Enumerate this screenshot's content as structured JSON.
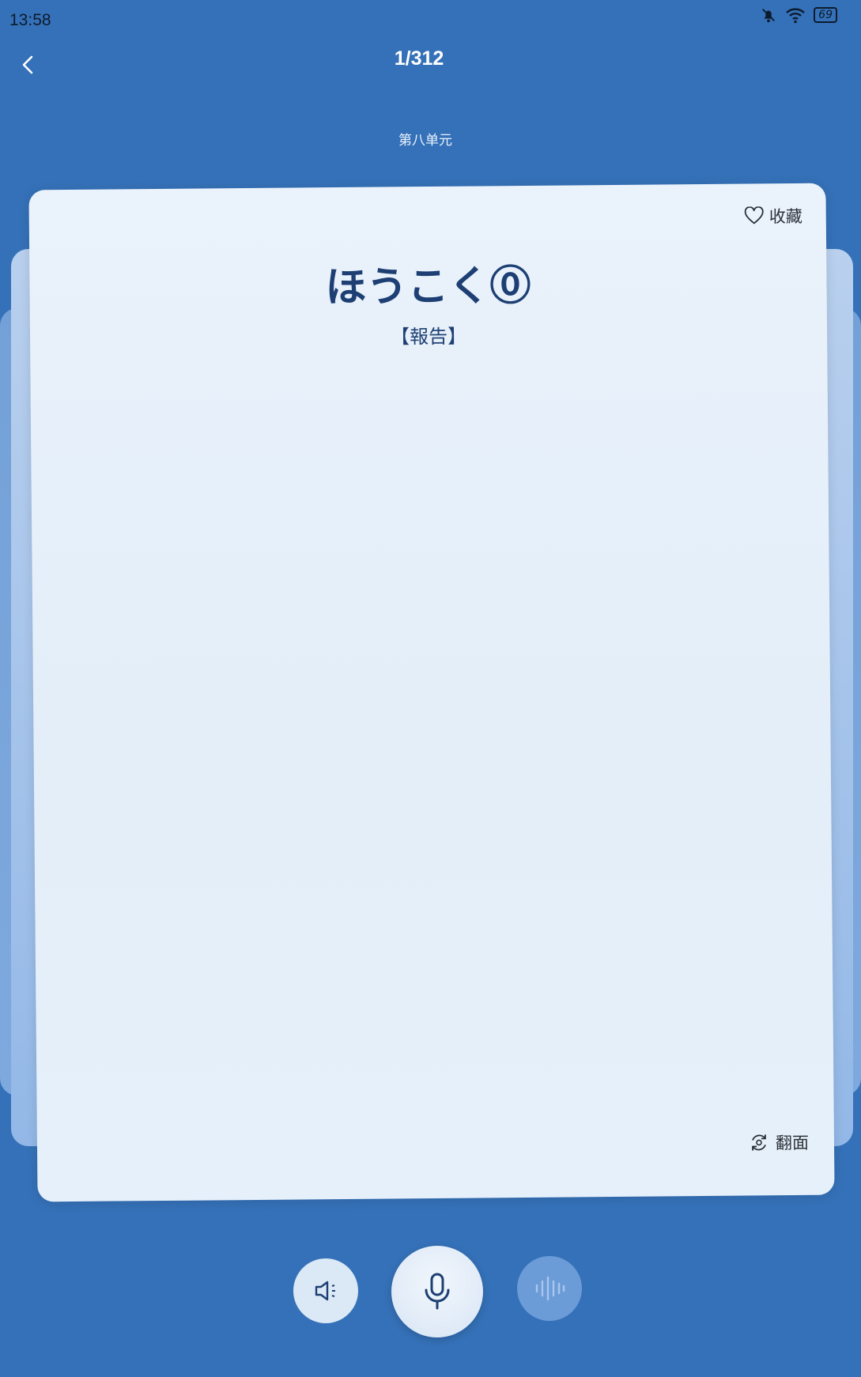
{
  "status_bar": {
    "time": "13:58",
    "battery": "69",
    "icons": [
      "bell-off-icon",
      "wifi-icon",
      "battery-icon"
    ]
  },
  "header": {
    "back_icon": "chevron-left-icon",
    "page_counter": "1/312",
    "unit": "第八单元"
  },
  "card": {
    "favorite_label": "收藏",
    "favorite_icon": "heart-outline-icon",
    "word_kana": "ほうこく⓪",
    "word_kanji": "【報告】",
    "flip_label": "翻面",
    "flip_icon": "flip-rotate-icon"
  },
  "controls": {
    "audio_icon": "speaker-icon",
    "mic_icon": "microphone-icon",
    "wave_icon": "waveform-icon"
  },
  "colors": {
    "background": "#3571b8",
    "card": "#e6f0fa",
    "word": "#1d3f73",
    "wave_button": "#6c9cd7"
  }
}
